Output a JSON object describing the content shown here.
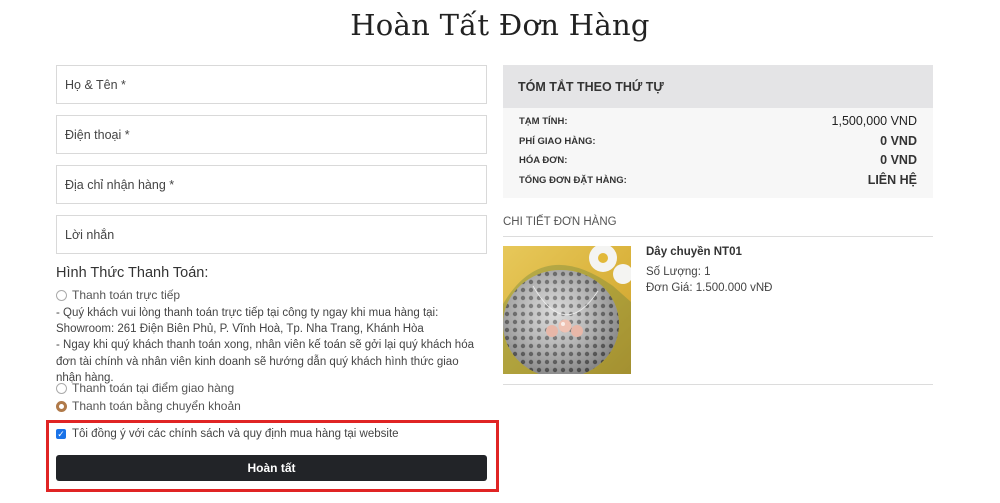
{
  "page_title": "Hoàn Tất Đơn Hàng",
  "form": {
    "name_placeholder": "Họ & Tên *",
    "phone_placeholder": "Điện thoại *",
    "address_placeholder": "Địa chỉ nhận hàng *",
    "message_placeholder": "Lời nhắn"
  },
  "payment": {
    "title": "Hình Thức Thanh Toán:",
    "options": [
      {
        "label": "Thanh toán trực tiếp",
        "checked": false
      },
      {
        "label": "Thanh toán tại điểm giao hàng",
        "checked": false
      },
      {
        "label": "Thanh toán bằng chuyển khoản",
        "checked": true
      }
    ],
    "direct_note_1": "- Quý khách vui lòng thanh toán trực tiếp tại công ty ngay khi mua hàng tại:",
    "direct_note_2": "Showroom: 261 Điện Biên Phủ, P. Vĩnh Hoà, Tp. Nha Trang, Khánh Hòa",
    "direct_note_3": "- Ngay khi quý khách thanh toán xong, nhân viên kế toán sẽ gởi lại quý khách hóa đơn tài chính và nhân viên kinh doanh sẽ hướng dẫn quý khách hình thức giao nhận hàng."
  },
  "agree": {
    "label": "Tôi đồng ý với các chính sách và quy định mua hàng tại website",
    "checked": true
  },
  "submit_label": "Hoàn tất",
  "summary": {
    "title": "TÓM TẮT THEO THỨ TỰ",
    "rows": [
      {
        "label": "TẠM TÍNH:",
        "value": "1,500,000 VND"
      },
      {
        "label": "PHÍ GIAO HÀNG:",
        "value": "0 VND"
      },
      {
        "label": "HÓA ĐƠN:",
        "value": "0 VND"
      },
      {
        "label": "TỔNG ĐƠN ĐẶT HÀNG:",
        "value": "LIÊN HỆ"
      }
    ]
  },
  "detail": {
    "title": "CHI TIẾT ĐƠN HÀNG",
    "product": {
      "name": "Dây chuyền NT01",
      "quantity": "Số Lượng: 1",
      "price": "Đơn Giá: 1.500.000 vNĐ"
    }
  },
  "colors": {
    "button_bg": "#222428",
    "highlight_border": "#e02424",
    "radio_checked": "#b07a4a",
    "summary_header_bg": "#e4e4e6"
  }
}
